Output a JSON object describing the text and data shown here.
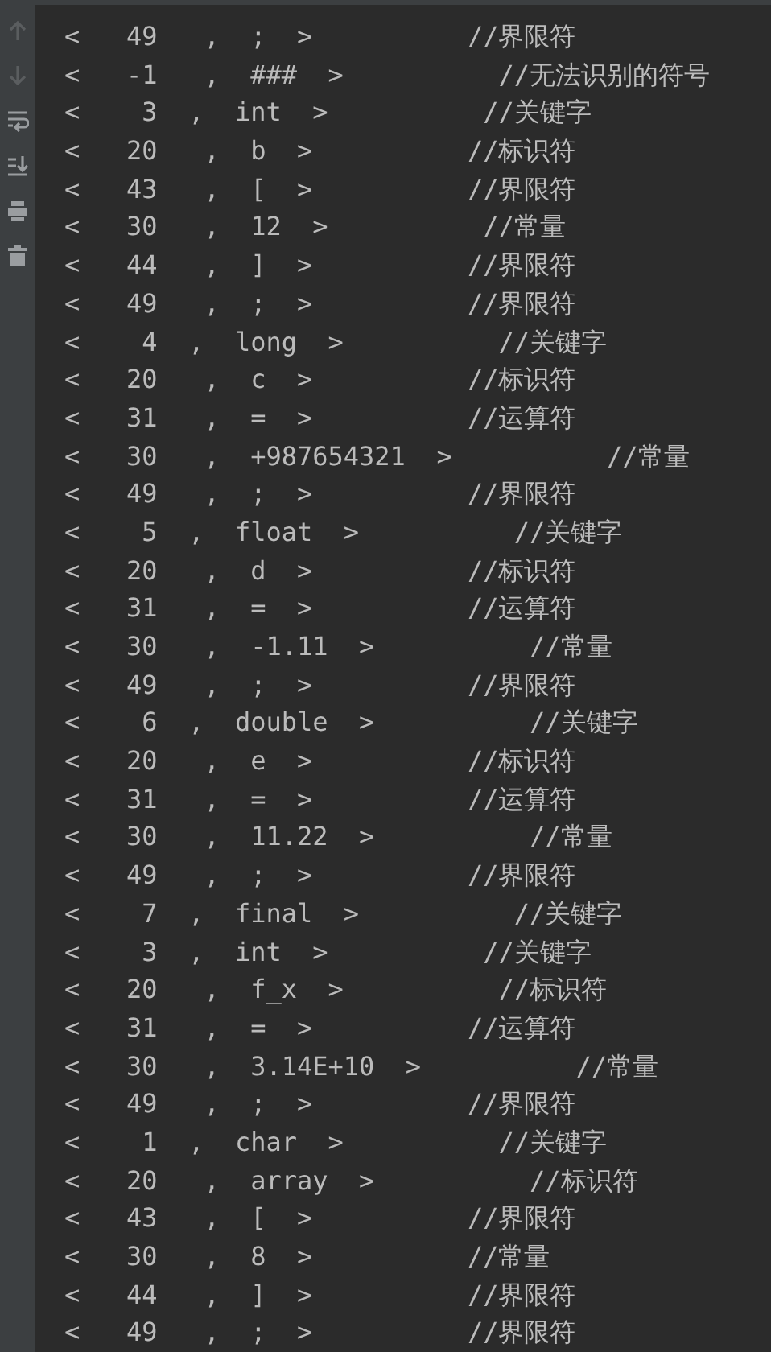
{
  "toolbar": [
    {
      "kind": "up",
      "disabled": true
    },
    {
      "kind": "down",
      "disabled": true
    },
    {
      "kind": "wrap",
      "disabled": false
    },
    {
      "kind": "scroll-end",
      "disabled": false
    },
    {
      "kind": "print",
      "disabled": false
    },
    {
      "kind": "trash",
      "disabled": false
    }
  ],
  "console_lines": [
    "<   49   ,  ;  >          //界限符",
    "<   -1   ,  ###  >          //无法识别的符号",
    "<    3  ,  int  >          //关键字",
    "<   20   ,  b  >          //标识符",
    "<   43   ,  [  >          //界限符",
    "<   30   ,  12  >          //常量",
    "<   44   ,  ]  >          //界限符",
    "<   49   ,  ;  >          //界限符",
    "<    4  ,  long  >          //关键字",
    "<   20   ,  c  >          //标识符",
    "<   31   ,  =  >          //运算符",
    "<   30   ,  +987654321  >          //常量",
    "<   49   ,  ;  >          //界限符",
    "<    5  ,  float  >          //关键字",
    "<   20   ,  d  >          //标识符",
    "<   31   ,  =  >          //运算符",
    "<   30   ,  -1.11  >          //常量",
    "<   49   ,  ;  >          //界限符",
    "<    6  ,  double  >          //关键字",
    "<   20   ,  e  >          //标识符",
    "<   31   ,  =  >          //运算符",
    "<   30   ,  11.22  >          //常量",
    "<   49   ,  ;  >          //界限符",
    "<    7  ,  final  >          //关键字",
    "<    3  ,  int  >          //关键字",
    "<   20   ,  f_x  >          //标识符",
    "<   31   ,  =  >          //运算符",
    "<   30   ,  3.14E+10  >          //常量",
    "<   49   ,  ;  >          //界限符",
    "<    1  ,  char  >          //关键字",
    "<   20   ,  array  >          //标识符",
    "<   43   ,  [  >          //界限符",
    "<   30   ,  8  >          //常量",
    "<   44   ,  ]  >          //界限符",
    "<   49   ,  ;  >          //界限符"
  ]
}
